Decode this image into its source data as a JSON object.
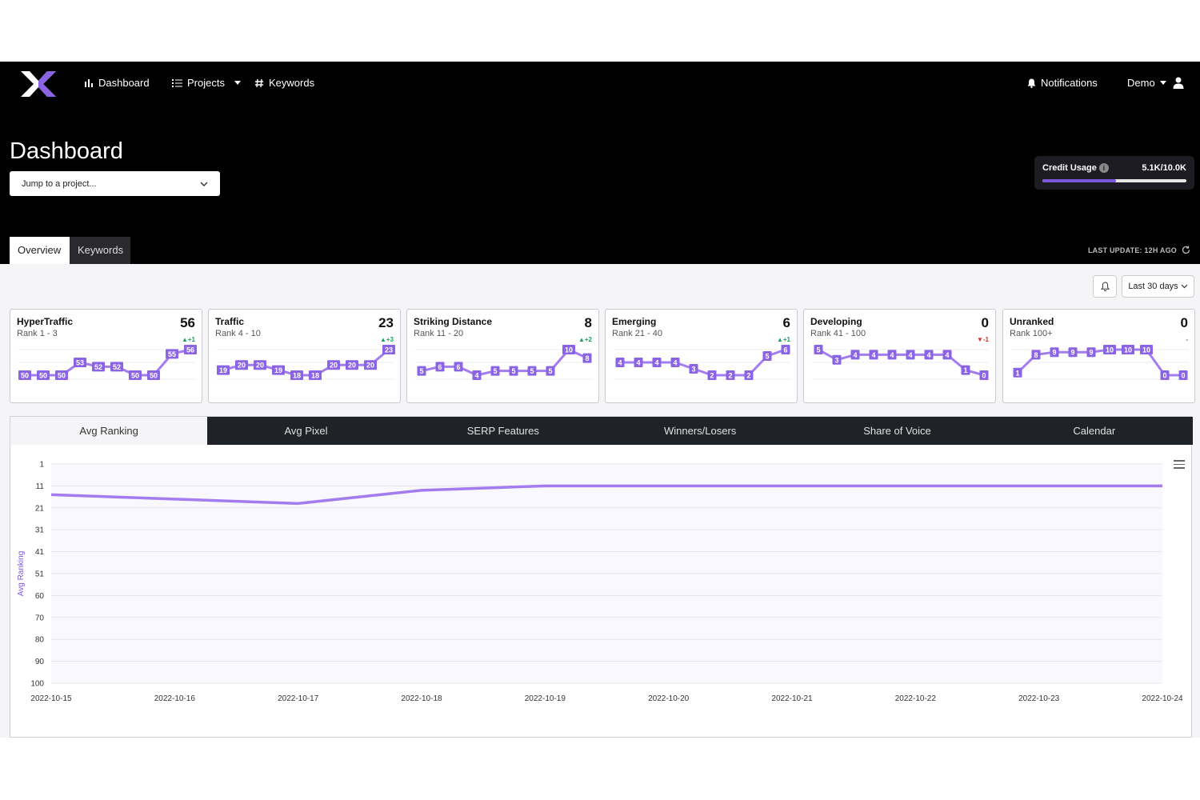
{
  "nav": {
    "items": [
      {
        "label": "Dashboard",
        "icon": "bar-chart-icon"
      },
      {
        "label": "Projects",
        "icon": "list-icon"
      },
      {
        "label": "Keywords",
        "icon": "hashtag-icon"
      }
    ],
    "notifications_label": "Notifications",
    "user_label": "Demo"
  },
  "page": {
    "title": "Dashboard",
    "jump_placeholder": "Jump to a project..."
  },
  "credit": {
    "label": "Credit Usage",
    "value": "5.1K/10.0K",
    "used": 5.1,
    "total": 10.0
  },
  "tabs": [
    "Overview",
    "Keywords"
  ],
  "last_update": "LAST UPDATE: 12H AGO",
  "date_range": "Last 30 days",
  "cards": [
    {
      "title": "HyperTraffic",
      "subtitle": "Rank 1 - 3",
      "count": "56",
      "delta": "+1",
      "trend": "up",
      "values": [
        50,
        50,
        50,
        53,
        52,
        52,
        50,
        50,
        55,
        56
      ]
    },
    {
      "title": "Traffic",
      "subtitle": "Rank 4 - 10",
      "count": "23",
      "delta": "+3",
      "trend": "up",
      "values": [
        19,
        20,
        20,
        19,
        18,
        18,
        20,
        20,
        20,
        23
      ]
    },
    {
      "title": "Striking Distance",
      "subtitle": "Rank 11 - 20",
      "count": "8",
      "delta": "+2",
      "trend": "up",
      "values": [
        5,
        6,
        6,
        4,
        5,
        5,
        5,
        5,
        10,
        8
      ]
    },
    {
      "title": "Emerging",
      "subtitle": "Rank 21 - 40",
      "count": "6",
      "delta": "+1",
      "trend": "up",
      "values": [
        4,
        4,
        4,
        4,
        3,
        2,
        2,
        2,
        5,
        6
      ]
    },
    {
      "title": "Developing",
      "subtitle": "Rank 41 - 100",
      "count": "0",
      "delta": "-1",
      "trend": "down",
      "values": [
        5,
        3,
        4,
        4,
        4,
        4,
        4,
        4,
        1,
        0
      ]
    },
    {
      "title": "Unranked",
      "subtitle": "Rank 100+",
      "count": "0",
      "delta": "-",
      "trend": "flat",
      "values": [
        1,
        8,
        9,
        9,
        9,
        10,
        10,
        10,
        0,
        0
      ]
    }
  ],
  "chart_tabs": [
    "Avg Ranking",
    "Avg Pixel",
    "SERP Features",
    "Winners/Losers",
    "Share of Voice",
    "Calendar"
  ],
  "chart_data": {
    "type": "line",
    "ylabel": "Avg Ranking",
    "y_ticks": [
      1,
      11,
      21,
      31,
      41,
      51,
      60,
      70,
      80,
      90,
      100
    ],
    "y_reversed": true,
    "x": [
      "2022-10-15",
      "2022-10-16",
      "2022-10-17",
      "2022-10-18",
      "2022-10-19",
      "2022-10-20",
      "2022-10-21",
      "2022-10-22",
      "2022-10-23",
      "2022-10-24"
    ],
    "series": [
      {
        "values": [
          15,
          17,
          19,
          13,
          11,
          11,
          11,
          11,
          11,
          11
        ]
      }
    ],
    "color": "#a37cf0"
  },
  "colors": {
    "accent": "#7b56d8",
    "spark_line": "#a37cf0",
    "spark_label": "#8b64e6",
    "up": "#1aa260",
    "down": "#d93025"
  }
}
